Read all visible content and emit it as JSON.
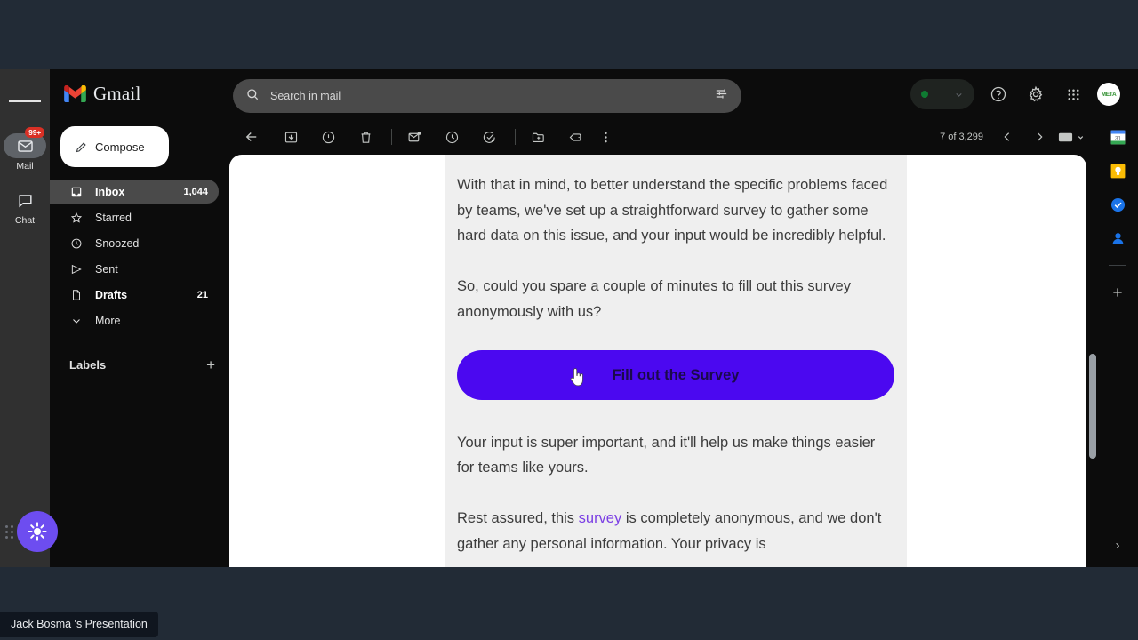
{
  "window": {
    "app_title": "Gmail"
  },
  "app_rail": {
    "menu_icon": "hamburger-icon",
    "items": [
      {
        "label": "Mail",
        "icon": "mail-icon",
        "badge": "99+",
        "active": true
      },
      {
        "label": "Chat",
        "icon": "chat-bubble-icon",
        "badge": "",
        "active": false
      }
    ]
  },
  "sidebar": {
    "brand": "Gmail",
    "compose_label": "Compose",
    "items": [
      {
        "label": "Inbox",
        "icon": "inbox-icon",
        "count": "1,044",
        "active": true
      },
      {
        "label": "Starred",
        "icon": "star-icon",
        "count": "",
        "active": false
      },
      {
        "label": "Snoozed",
        "icon": "clock-icon",
        "count": "",
        "active": false
      },
      {
        "label": "Sent",
        "icon": "send-icon",
        "count": "",
        "active": false
      },
      {
        "label": "Drafts",
        "icon": "document-icon",
        "count": "21",
        "active": false
      },
      {
        "label": "More",
        "icon": "chevron-down-icon",
        "count": "",
        "active": false
      }
    ],
    "labels_heading": "Labels",
    "add_label_glyph": "+"
  },
  "search": {
    "placeholder": "Search in mail",
    "value": "",
    "search_icon": "search-icon",
    "options_icon": "search-options-icon"
  },
  "topbar_right": {
    "status_pill": {
      "dot_color": "#0f7b32",
      "chevron": "chevron-down-icon"
    },
    "help_label": "?",
    "settings_icon": "gear-icon",
    "apps_icon": "apps-grid-icon",
    "avatar_text": "META"
  },
  "mail_toolbar": {
    "buttons": [
      {
        "name": "back-to-inbox-button",
        "icon": "arrow-left-icon"
      },
      {
        "name": "archive-button",
        "icon": "archive-icon"
      },
      {
        "name": "report-spam-button",
        "icon": "report-spam-icon"
      },
      {
        "name": "delete-button",
        "icon": "trash-icon"
      },
      {
        "name": "mark-unread-button",
        "icon": "mark-unread-icon"
      },
      {
        "name": "snooze-button",
        "icon": "clock-icon"
      },
      {
        "name": "add-to-tasks-button",
        "icon": "add-to-tasks-icon"
      },
      {
        "name": "move-to-button",
        "icon": "move-to-folder-icon"
      },
      {
        "name": "labels-button",
        "icon": "label-tag-icon"
      },
      {
        "name": "more-options-button",
        "icon": "more-vertical-icon"
      }
    ],
    "pagination": "7 of 3,299",
    "prev_glyph": "‹",
    "next_glyph": "›",
    "layout_icon": "input-tools-icon",
    "layout_chevron": "chevron-down-icon"
  },
  "email": {
    "paragraphs": [
      "With that in mind, to better understand the specific problems faced by teams, we've set up a straightforward survey to gather some hard data on this issue, and your input would be incredibly helpful.",
      "So, could you spare a couple of minutes to fill out this survey anonymously with us?"
    ],
    "cta_label": "Fill out the Survey",
    "cta_color": "#4b08f0",
    "after_cta": "Your input is super important, and it'll help us make things easier for teams like yours.",
    "closing_prefix": "Rest assured, this ",
    "closing_link": "survey",
    "closing_suffix": " is completely anonymous, and we don't gather any personal information. Your privacy is",
    "link_color": "#7b3fe4"
  },
  "side_panel": {
    "items": [
      {
        "name": "google-calendar-icon",
        "label": "Calendar",
        "day": "31"
      },
      {
        "name": "google-keep-icon",
        "label": "Keep",
        "day": ""
      },
      {
        "name": "google-tasks-icon",
        "label": "Tasks",
        "day": ""
      },
      {
        "name": "google-contacts-icon",
        "label": "Contacts",
        "day": ""
      }
    ],
    "add_glyph": "+",
    "expand_glyph": "›"
  },
  "assistant": {
    "icon": "sparkle-sun-icon",
    "color": "#6d4df0"
  },
  "presenter": {
    "label": "Jack Bosma 's Presentation"
  }
}
